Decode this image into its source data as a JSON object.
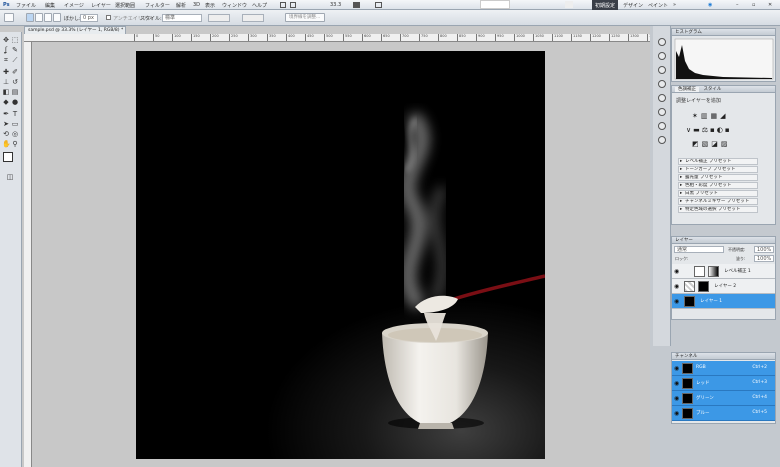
{
  "menu": {
    "items": [
      "ファイル",
      "編集",
      "イメージ",
      "レイヤー",
      "選択範囲",
      "フィルター",
      "解析",
      "3D",
      "表示",
      "ウィンドウ",
      "ヘルプ"
    ],
    "zoom": "33.3",
    "workspace": "初期設定",
    "design": "デザイン",
    "paint": "ペイント"
  },
  "options": {
    "feather_label": "ぼかし:",
    "feather_value": "0 px",
    "antialias": "アンチエイリアス",
    "style_label": "スタイル:",
    "style_value": "標準",
    "refine_edge": "境界線を調整..."
  },
  "document": {
    "tab_title": "sample.psd @ 33.3% (レイヤー 1, RGB/8) *"
  },
  "ruler": {
    "marks": [
      "0",
      "50",
      "100",
      "150",
      "200",
      "250",
      "300",
      "350",
      "400",
      "450",
      "500",
      "550",
      "600",
      "650",
      "700",
      "750",
      "800",
      "850",
      "900",
      "950",
      "1000",
      "1050",
      "1100",
      "1150",
      "1200",
      "1250",
      "1300",
      "1350",
      "1400",
      "1450",
      "1500",
      "1550",
      "1600",
      "1650"
    ]
  },
  "panels": {
    "histogram_title": "ヒストグラム",
    "adjustments_tab": "色調補正",
    "styles_tab": "スタイル",
    "adjust_add": "調整レイヤーを追加",
    "presets": [
      "レベル補正 プリセット",
      "トーンカーブ プリセット",
      "露光量 プリセット",
      "色相・彩度 プリセット",
      "白黒 プリセット",
      "チャンネルミキサー プリセット",
      "特定色域の選択 プリセット"
    ],
    "layers_tab": "レイヤー",
    "blend_mode": "通常",
    "opacity_label": "不透明度:",
    "opacity_value": "100%",
    "lock_label": "ロック:",
    "fill_label": "塗り:",
    "fill_value": "100%",
    "layers": [
      {
        "name": "レベル補正 1",
        "selected": false
      },
      {
        "name": "レイヤー 2",
        "selected": false
      },
      {
        "name": "レイヤー 1",
        "selected": true
      }
    ],
    "channels_tab": "チャンネル",
    "channels": [
      {
        "name": "RGB",
        "key": "Ctrl+2"
      },
      {
        "name": "レッド",
        "key": "Ctrl+3"
      },
      {
        "name": "グリーン",
        "key": "Ctrl+4"
      },
      {
        "name": "ブルー",
        "key": "Ctrl+5"
      }
    ]
  },
  "colors": {
    "selection": "#3c98e6",
    "canvas_bg": "#000000",
    "workspace": "#c8c8c8"
  }
}
